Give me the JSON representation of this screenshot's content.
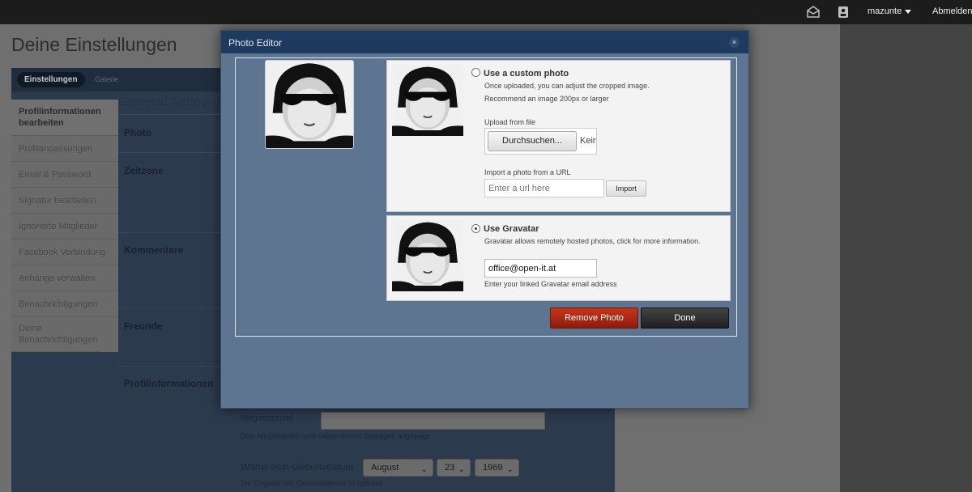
{
  "topbar": {
    "mail_icon": "envelope-icon",
    "profile_icon": "id-card-icon",
    "username": "mazunte",
    "logout_label": "Abmelden"
  },
  "page": {
    "title": "Deine Einstellungen",
    "tabs": [
      {
        "label": "Einstellungen",
        "active": true
      },
      {
        "label": "Galerie",
        "active": false
      }
    ],
    "sidebar": [
      {
        "label": "Profilinformationen bearbeiten",
        "active": true
      },
      {
        "label": "Profilanpassungen"
      },
      {
        "label": "Email & Password"
      },
      {
        "label": "Signatur bearbeiten"
      },
      {
        "label": "Ignorierte Mitglieder"
      },
      {
        "label": "Facebook Verbindung"
      },
      {
        "label": "Anhänge verwalten"
      },
      {
        "label": "Benachrichtigungen"
      },
      {
        "label": "Deine Benachrichtigungen"
      }
    ],
    "section_heading": "General Account",
    "sections": [
      "Photo",
      "Zeitzone",
      "Kommentare",
      "Freunde",
      "Profilinformationen"
    ],
    "member_title_label": "Mitgliedertitel",
    "member_title_hint": "Dein Mitgliedertitel wird neben deinen Beiträgen angezeigt",
    "birthday_label": "Wähle dein Geburtsdatum",
    "birthday": {
      "month": "August",
      "day": "23",
      "year": "1969"
    },
    "birthday_hint": "Die Eingabe des Geburtsdatums ist optional"
  },
  "modal": {
    "title": "Photo Editor",
    "close_icon": "close-icon",
    "custom": {
      "title": "Use a custom photo",
      "desc1": "Once uploaded, you can adjust the cropped image.",
      "desc2": "Recommend an image 200px or larger",
      "upload_label": "Upload from file",
      "browse_label": "Durchsuchen...",
      "browse_status": "Keine Datei ausgewählt.",
      "url_label": "Import a photo from a URL",
      "url_placeholder": "Enter a url here",
      "import_label": "Import",
      "selected": false
    },
    "gravatar": {
      "title": "Use Gravatar",
      "desc": "Gravatar allows remotely hosted photos, click for more information.",
      "email": "office@open-it.at",
      "hint": "Enter your linked Gravatar email address",
      "selected": true
    },
    "remove_label": "Remove Photo",
    "done_label": "Done"
  }
}
